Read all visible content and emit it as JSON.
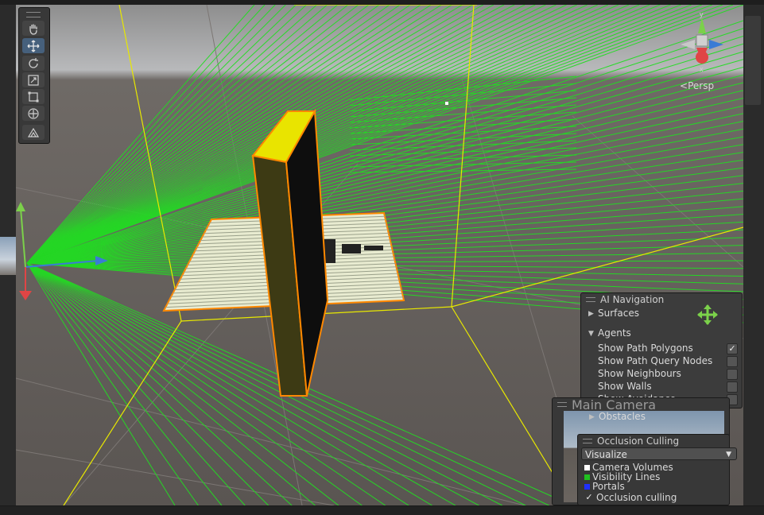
{
  "viewport": {
    "camera_mode": "Persp",
    "gizmo_axes": {
      "y": "y",
      "x": "x"
    }
  },
  "toolbar": {
    "tools": [
      "hand-tool",
      "move-tool",
      "rotate-tool",
      "scale-tool",
      "rect-tool",
      "transform-tool",
      "custom-tool"
    ],
    "active": "move-tool"
  },
  "ai_navigation": {
    "title": "AI Navigation",
    "surfaces_label": "Surfaces",
    "agents_label": "Agents",
    "options": [
      {
        "label": "Show Path Polygons",
        "checked": true
      },
      {
        "label": "Show Path Query Nodes",
        "checked": false
      },
      {
        "label": "Show Neighbours",
        "checked": false
      },
      {
        "label": "Show Walls",
        "checked": false
      },
      {
        "label": "Show Avoidance",
        "checked": false
      }
    ],
    "obstacles_label": "Obstacles"
  },
  "main_camera": {
    "title": "Main Camera"
  },
  "occlusion_culling": {
    "title": "Occlusion Culling",
    "mode": "Visualize",
    "legend": [
      {
        "label": "Camera Volumes",
        "color": "#ffffff"
      },
      {
        "label": "Visibility Lines",
        "color": "#20c020"
      },
      {
        "label": "Portals",
        "color": "#2030ff"
      }
    ],
    "occlusion_label": "Occlusion culling",
    "occlusion_checked": true
  },
  "colors": {
    "accent_active_tool": "#46607c",
    "gizmo_y": "#7bd14a",
    "gizmo_x": "#e04545",
    "gizmo_z": "#3a7bd5",
    "frustum_yellow": "#e8e800",
    "visibility_green": "#22dd22"
  }
}
